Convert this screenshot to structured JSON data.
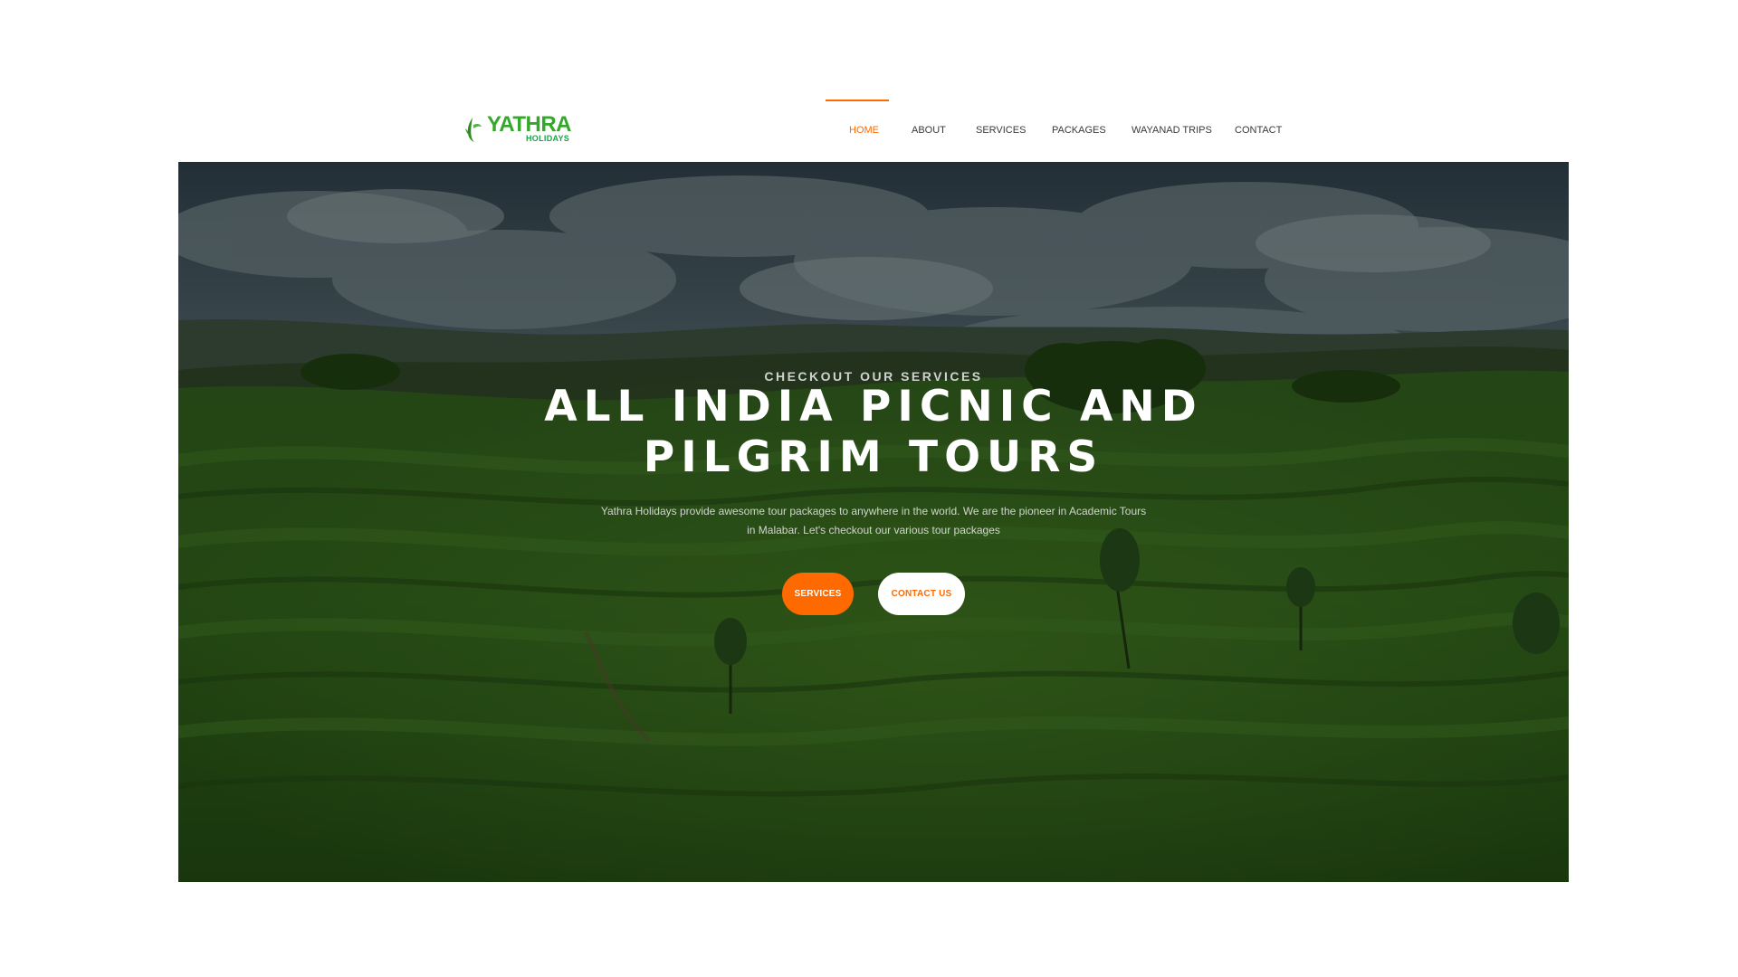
{
  "colors": {
    "accent": "#ff6a00",
    "logo_green": "#34a82a",
    "logo_sub_green": "#1aa34a",
    "nav_text": "#3a3a3a",
    "nav_active": "#ff6a00",
    "btn_primary_bg": "#ff6a00",
    "btn_primary_text": "#ffffff",
    "btn_secondary_bg": "#ffffff",
    "btn_secondary_text": "#ff6a00"
  },
  "logo": {
    "name": "YATHRA",
    "sub": "HOLIDAYS",
    "icon": "leaf-bird-icon"
  },
  "nav": {
    "items": [
      {
        "label": "HOME",
        "active": true
      },
      {
        "label": "ABOUT",
        "active": false
      },
      {
        "label": "SERVICES",
        "active": false
      },
      {
        "label": "PACKAGES",
        "active": false
      },
      {
        "label": "WAYANAD TRIPS",
        "active": false
      },
      {
        "label": "CONTACT",
        "active": false
      }
    ]
  },
  "hero": {
    "eyebrow": "CHECKOUT OUR SERVICES",
    "title": "ALL INDIA PICNIC AND PILGRIM TOURS",
    "text": "Yathra Holidays provide awesome tour packages to anywhere in the world. We are the pioneer in Academic Tours in Malabar. Let's checkout our various tour packages",
    "buttons": {
      "primary": "SERVICES",
      "secondary": "CONTACT US"
    }
  }
}
